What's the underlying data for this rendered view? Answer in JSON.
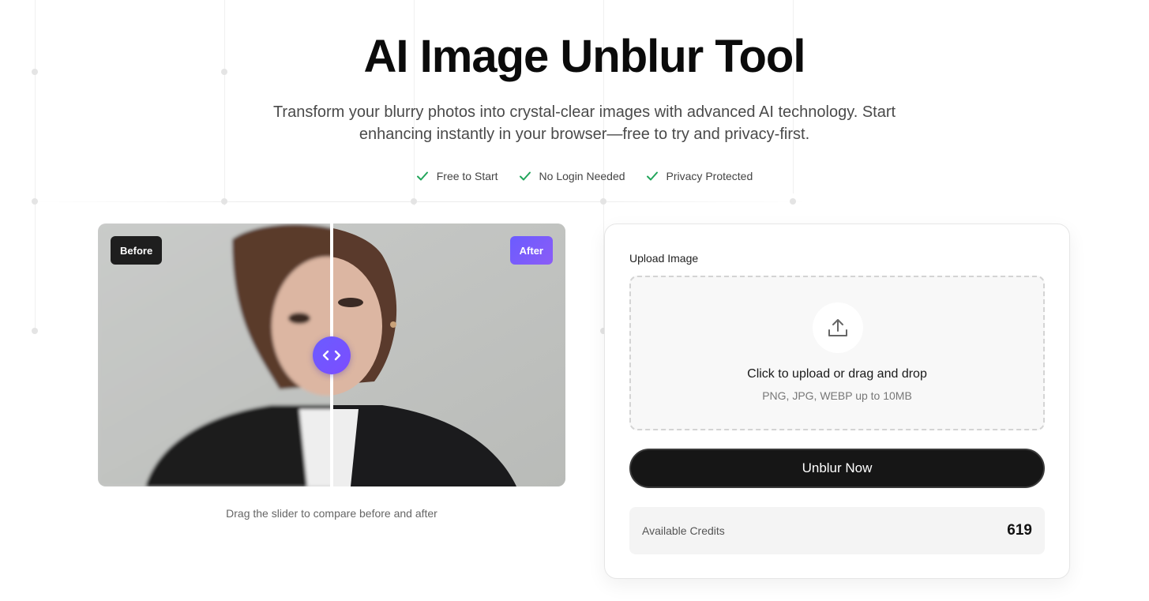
{
  "hero": {
    "title": "AI Image Unblur Tool",
    "subtitle": "Transform your blurry photos into crystal-clear images with advanced AI technology. Start enhancing instantly in your browser—free to try and privacy-first."
  },
  "features": [
    {
      "label": "Free to Start",
      "icon": "check-icon"
    },
    {
      "label": "No Login Needed",
      "icon": "check-icon"
    },
    {
      "label": "Privacy Protected",
      "icon": "check-icon"
    }
  ],
  "compare": {
    "before_label": "Before",
    "after_label": "After",
    "slider_position_percent": 50,
    "hint": "Drag the slider to compare before and after"
  },
  "upload": {
    "label": "Upload Image",
    "drop_main": "Click to upload or drag and drop",
    "drop_sub": "PNG, JPG, WEBP up to 10MB",
    "icon": "upload-icon"
  },
  "action": {
    "button_label": "Unblur Now"
  },
  "credits": {
    "label": "Available Credits",
    "value": "619"
  },
  "colors": {
    "accent": "#6b5cff",
    "check": "#22a55b",
    "button": "#161616"
  }
}
